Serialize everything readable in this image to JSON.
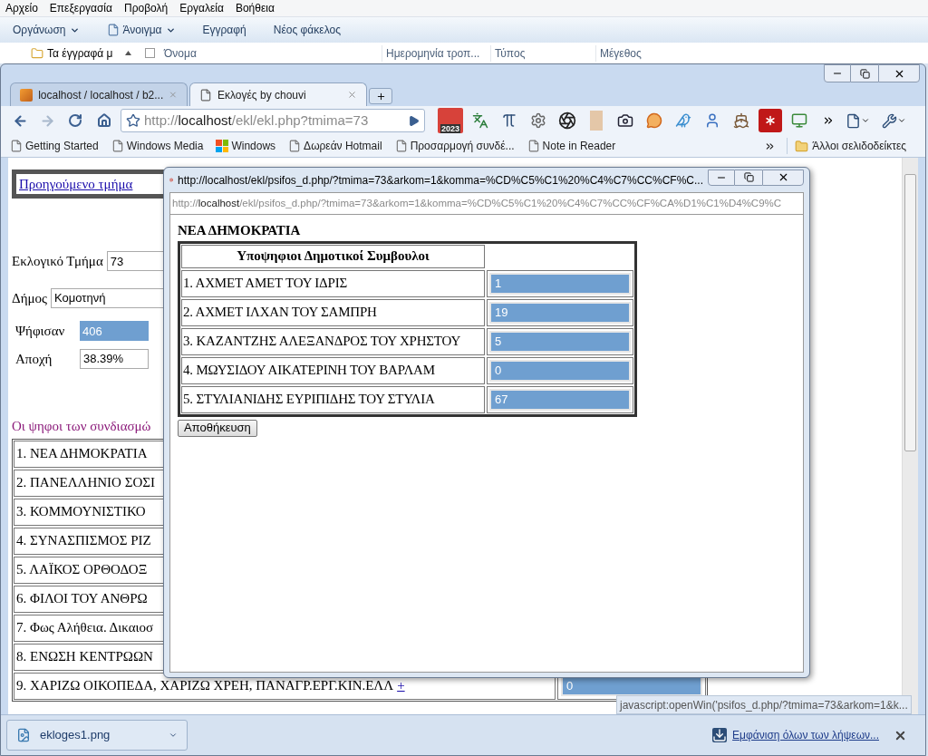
{
  "explorer": {
    "menu": [
      "Αρχείο",
      "Επεξεργασία",
      "Προβολή",
      "Εργαλεία",
      "Βοήθεια"
    ],
    "toolbar": [
      {
        "label": "Οργάνωση",
        "dropdown": true,
        "kind": "plain"
      },
      {
        "label": "Άνοιγμα",
        "dropdown": true,
        "kind": "notepad"
      },
      {
        "label": "Εγγραφή",
        "dropdown": false,
        "kind": "plain"
      },
      {
        "label": "Νέος φάκελος",
        "dropdown": false,
        "kind": "plain"
      }
    ],
    "sidebar_item": "Τα έγγραφά μ",
    "columns": [
      "Όνομα",
      "Ημερομηνία τροπ...",
      "Τύπος",
      "Μέγεθος"
    ]
  },
  "browser": {
    "tabs": [
      {
        "title": "localhost / localhost / b2...",
        "selected": false,
        "kind": "pma"
      },
      {
        "title": "Εκλογές by chouvi",
        "selected": true,
        "kind": "page"
      }
    ],
    "address": {
      "scheme": "http://",
      "host": "localhost",
      "path": "/ekl/ekl.php?tmima=73"
    },
    "extension_badge": "2023",
    "bookmarks": [
      {
        "label": "Getting Started",
        "kind": "page"
      },
      {
        "label": "Windows Media",
        "kind": "page"
      },
      {
        "label": "Windows",
        "kind": "windows"
      },
      {
        "label": "Δωρεάν Hotmail",
        "kind": "page"
      },
      {
        "label": "Προσαρμογή συνδέ...",
        "kind": "page"
      },
      {
        "label": "Note in Reader",
        "kind": "page"
      }
    ],
    "other_bookmarks": "Άλλοι σελιδοδείκτες"
  },
  "page": {
    "prev_link": "Προηγούμενο τμήμα",
    "fields": [
      {
        "label": "Εκλογικό Τμήμα",
        "value": "73",
        "kind": "wide"
      },
      {
        "label": "Δήμος",
        "value": "Κομοτηνή",
        "kind": "wide"
      }
    ],
    "stats": [
      {
        "label": "Ψήφισαν",
        "value": "406",
        "highlighted": true
      },
      {
        "label": "Αποχή",
        "value": "38.39%",
        "highlighted": false
      }
    ],
    "section_title": "Οι ψηφοι των συνδιασμώ",
    "parties": [
      {
        "name": "1. ΝΕΑ ΔΗΜΟΚΡΑΤΙΑ"
      },
      {
        "name": "2. ΠΑΝΕΛΛΗΝΙΟ ΣΟΣΙ"
      },
      {
        "name": "3. ΚΟΜΜΟΥΝΙΣΤΙΚΟ"
      },
      {
        "name": "4. ΣΥΝΑΣΠΙΣΜΟΣ ΡΙΖ"
      },
      {
        "name": "5. ΛΑΪΚΟΣ ΟΡΘΟΔΟΞ"
      },
      {
        "name": "6. ΦΙΛΟΙ ΤΟΥ ΑΝΘΡΩ"
      },
      {
        "name": "7. Φως Αλήθεια. Δικαιοσ"
      },
      {
        "name": "8. ΕΝΩΣΗ ΚΕΝΤΡΩΩΝ"
      },
      {
        "name": "9. ΧΑΡΙΖΩ ΟΙΚΟΠΕΔΑ, ΧΑΡΙΖΩ ΧΡΕΗ, ΠΑΝΑΓΡ.ΕΡΓ.ΚΙΝ.ΕΛΛ",
        "link": "+",
        "votes": "0"
      }
    ]
  },
  "popup": {
    "title": "http://localhost/ekl/psifos_d.php/?tmima=73&arkom=1&komma=%CD%C5%C1%20%C4%C7%CC%CF%C...",
    "url": {
      "scheme": "http://",
      "host": "localhost",
      "path": "/ekl/psifos_d.php/?tmima=73&arkom=1&komma=%CD%C5%C1%20%C4%C7%CC%CF%CA%D1%C1%D4%C9%C"
    },
    "party": "ΝΕΑ ΔΗΜΟΚΡΑΤΙΑ",
    "column_header": "Υποψηφιοι Δημοτικοί Συμβουλοι",
    "candidates": [
      {
        "name": "1. ΑΧΜΕΤ ΑΜΕΤ ΤΟΥ ΙΔΡΙΣ",
        "votes": "1"
      },
      {
        "name": "2. ΑΧΜΕΤ ΙΛΧΑΝ ΤΟΥ ΣΑΜΠΡΗ",
        "votes": "19"
      },
      {
        "name": "3. ΚΑΖΑΝΤΖΗΣ ΑΛΕΞΑΝΔΡΟΣ ΤΟΥ ΧΡΗΣΤΟΥ",
        "votes": "5"
      },
      {
        "name": "4. ΜΩΥΣΙΔΟΥ ΑΙΚΑΤΕΡΙΝΗ ΤΟΥ ΒΑΡΛΑΜ",
        "votes": "0"
      },
      {
        "name": "5. ΣΤΥΛΙΑΝΙΔΗΣ ΕΥΡΙΠΙΔΗΣ ΤΟΥ ΣΤΥΛΙΑ",
        "votes": "67"
      }
    ],
    "save_button": "Αποθήκευση"
  },
  "status_tooltip": "javascript:openWin('psifos_d.php/?tmima=73&arkom=1&k...",
  "downloads": {
    "file": "ekloges1.png",
    "show_all": "Εμφάνιση όλων των λήψεων..."
  }
}
